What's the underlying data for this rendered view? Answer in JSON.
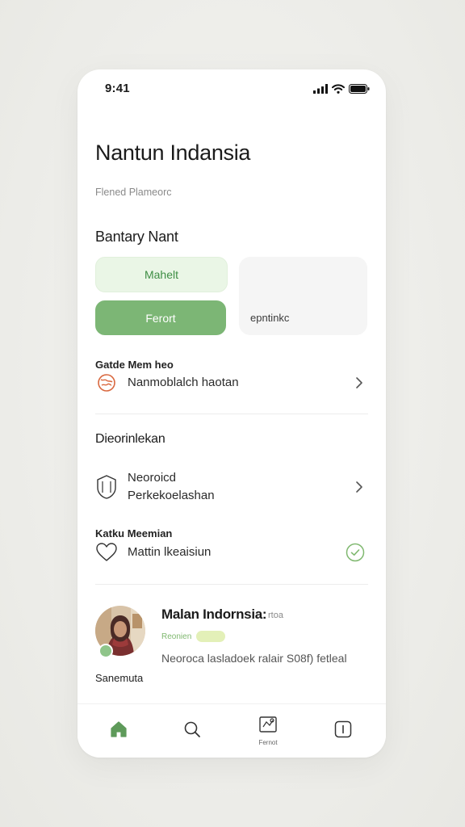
{
  "status_bar": {
    "time": "9:41",
    "icons": [
      "signal-icon",
      "wifi-icon",
      "battery-icon"
    ]
  },
  "header": {
    "title": "Nantun Indansia",
    "subtitle": "Flened Plameorc"
  },
  "plan_section": {
    "title": "Bantary Nant",
    "chip_light_label": "Mahelt",
    "chip_solid_label": "Ferort",
    "option_card_label": "epntinkc"
  },
  "row_one": {
    "heading": "Gatde Mem heo",
    "label": "Nanmoblalch haotan",
    "icon": "globe-icon",
    "trailing_icon": "chevron-right-icon"
  },
  "discover_section": {
    "title": "Dieorinlekan",
    "item": {
      "line1": "Neoroicd",
      "line2": "Perkekoelashan",
      "icon": "shield-icon",
      "trailing_icon": "chevron-right-icon"
    }
  },
  "row_three": {
    "heading": "Katku Meemian",
    "label": "Mattin lkeaisiun",
    "icon": "heart-icon",
    "trailing_icon": "check-circle-icon"
  },
  "profile": {
    "name": "Malan Indornsia:",
    "name_tag": "rtoa",
    "meta_label": "Reonien",
    "badge": "",
    "description": "Neoroca lasladoek ralair S08f) fetleal",
    "caption": "Sanemuta"
  },
  "tab_bar": {
    "items": [
      {
        "icon": "home-icon",
        "label": ""
      },
      {
        "icon": "search-icon",
        "label": ""
      },
      {
        "icon": "map-icon",
        "label": "Fernot"
      },
      {
        "icon": "info-icon",
        "label": ""
      }
    ]
  },
  "colors": {
    "accent": "#7cb675",
    "accent_light": "#eaf6e6",
    "accent_text": "#3f8e45",
    "check": "#7fb86f",
    "icon_orange": "#d9683f"
  }
}
